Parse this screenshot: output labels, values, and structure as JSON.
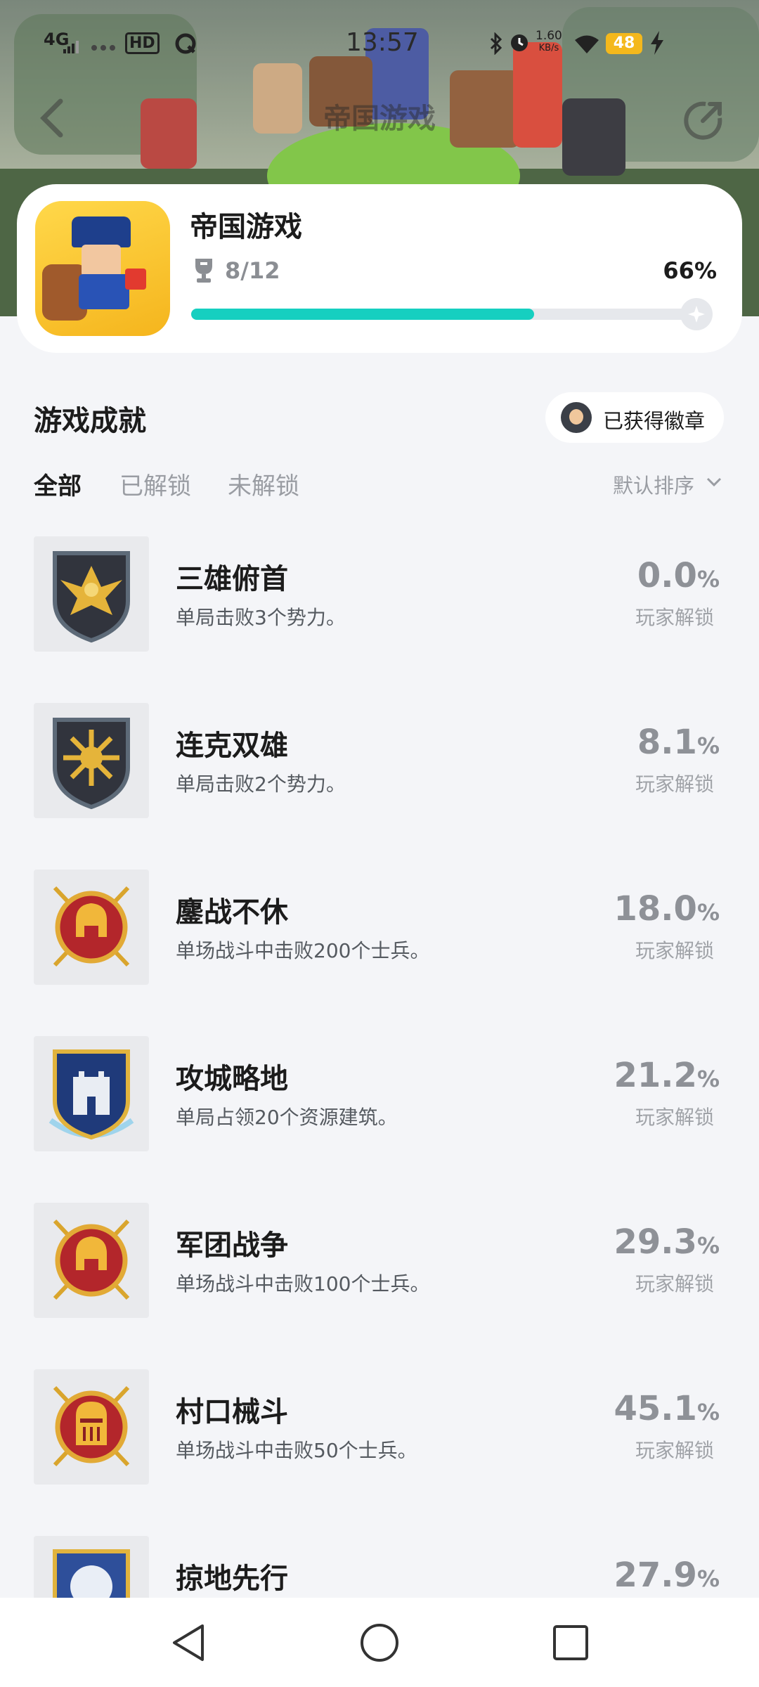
{
  "status_bar": {
    "signal": "4G",
    "hd": "HD",
    "time": "13:57",
    "net_speed_value": "1.60",
    "net_speed_unit": "KB/s",
    "battery": "48"
  },
  "nav": {
    "title": "帝国游戏",
    "back_icon": "chevron-left-icon",
    "share_icon": "share-icon"
  },
  "game": {
    "name": "帝国游戏",
    "progress_text": "8/12",
    "percent_text": "66%",
    "progress_fraction": 0.66
  },
  "section": {
    "title": "游戏成就",
    "badges_button": "已获得徽章"
  },
  "tabs": [
    {
      "label": "全部",
      "active": true
    },
    {
      "label": "已解锁",
      "active": false
    },
    {
      "label": "未解锁",
      "active": false
    }
  ],
  "sort": {
    "label": "默认排序"
  },
  "achievements": [
    {
      "name": "三雄俯首",
      "desc": "单局击败3个势力。",
      "pct_value": "0.0",
      "pct_unit": "%",
      "pct_label": "玩家解锁",
      "icon": "eagle-shield-icon"
    },
    {
      "name": "连克双雄",
      "desc": "单局击败2个势力。",
      "pct_value": "8.1",
      "pct_unit": "%",
      "pct_label": "玩家解锁",
      "icon": "sun-shield-icon"
    },
    {
      "name": "鏖战不休",
      "desc": "单场战斗中击败200个士兵。",
      "pct_value": "18.0",
      "pct_unit": "%",
      "pct_label": "玩家解锁",
      "icon": "gold-helmet-medal-icon"
    },
    {
      "name": "攻城略地",
      "desc": "单局占领20个资源建筑。",
      "pct_value": "21.2",
      "pct_unit": "%",
      "pct_label": "玩家解锁",
      "icon": "castle-shield-icon"
    },
    {
      "name": "军团战争",
      "desc": "单场战斗中击败100个士兵。",
      "pct_value": "29.3",
      "pct_unit": "%",
      "pct_label": "玩家解锁",
      "icon": "gold-helmet-medal-icon"
    },
    {
      "name": "村口械斗",
      "desc": "单场战斗中击败50个士兵。",
      "pct_value": "45.1",
      "pct_unit": "%",
      "pct_label": "玩家解锁",
      "icon": "knight-helmet-medal-icon"
    },
    {
      "name": "掠地先行",
      "desc": "",
      "pct_value": "27.9",
      "pct_unit": "%",
      "pct_label": "",
      "icon": "blue-shield-icon"
    }
  ],
  "colors": {
    "accent": "#16cfc0",
    "background": "#f4f5f8",
    "battery": "#f4b81c"
  }
}
